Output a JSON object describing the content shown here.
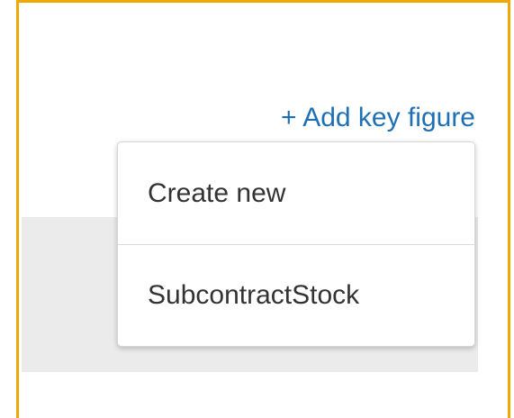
{
  "add_key_figure": {
    "label": "+ Add key figure",
    "color": "#1f6fb4"
  },
  "menu": {
    "items": [
      {
        "label": "Create new"
      },
      {
        "label": "SubcontractStock"
      }
    ]
  },
  "colors": {
    "frame_border": "#f0a800",
    "panel_background": "#ebebeb"
  }
}
